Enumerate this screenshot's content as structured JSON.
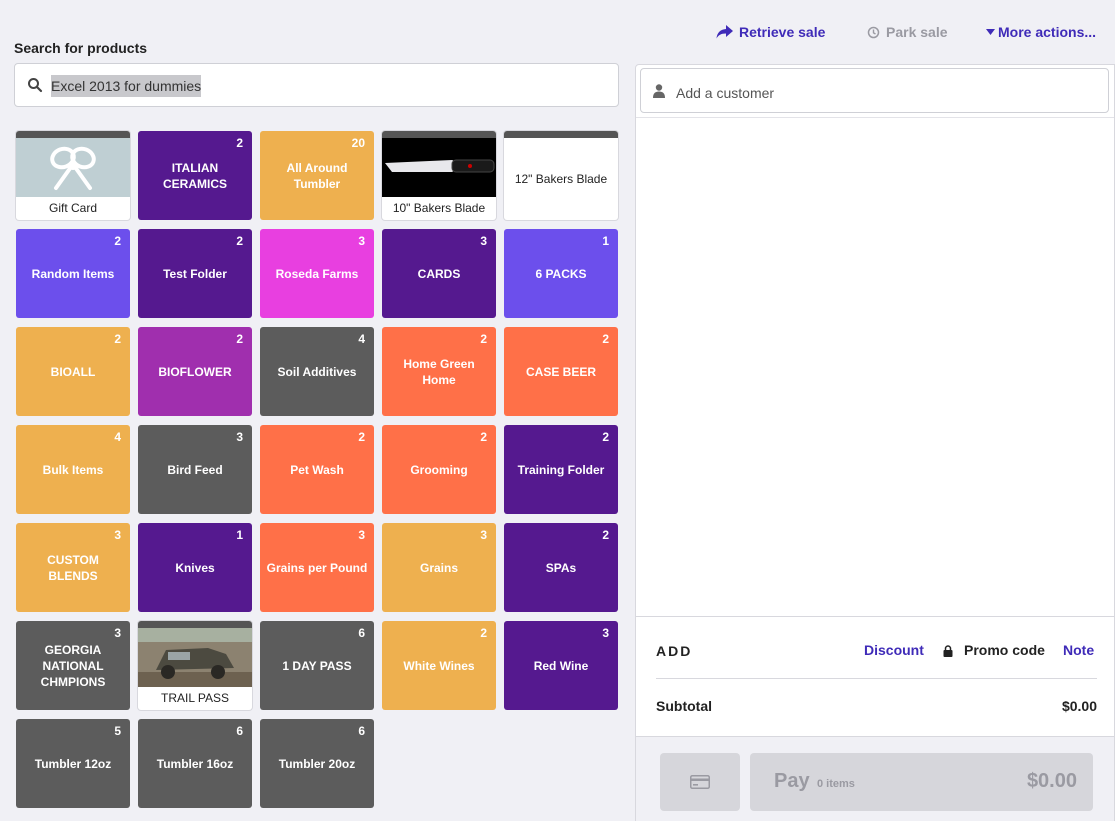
{
  "search": {
    "label": "Search for products",
    "value": "Excel 2013 for dummies"
  },
  "actions": {
    "retrieve": "Retrieve sale",
    "park": "Park sale",
    "more": "More actions..."
  },
  "customer": {
    "placeholder": "Add a customer"
  },
  "summary": {
    "add": "ADD",
    "discount": "Discount",
    "promo": "Promo code",
    "note": "Note",
    "subtotal_label": "Subtotal",
    "subtotal_value": "$0.00"
  },
  "pay": {
    "label": "Pay",
    "items": "0 items",
    "amount": "$0.00"
  },
  "colors": {
    "purple": "#55198f",
    "violet": "#6c4fec",
    "magenta": "#e83fe0",
    "orange": "#eeb04f",
    "coral": "#ff7048",
    "gray": "#5c5c5c",
    "plum": "#a02fae",
    "accent": "#3f2bb8"
  },
  "tiles": [
    {
      "name": "Gift Card",
      "kind": "product",
      "image": "gift-icon"
    },
    {
      "name": "ITALIAN CERAMICS",
      "count": "2",
      "color": "purple"
    },
    {
      "name": "All Around Tumbler",
      "count": "20",
      "color": "orange"
    },
    {
      "name": "10\" Bakers Blade",
      "kind": "product",
      "image": "knife-photo"
    },
    {
      "name": "12\" Bakers Blade",
      "kind": "product",
      "image": ""
    },
    {
      "name": "Random Items",
      "count": "2",
      "color": "violet"
    },
    {
      "name": "Test Folder",
      "count": "2",
      "color": "purple"
    },
    {
      "name": "Roseda Farms",
      "count": "3",
      "color": "magenta"
    },
    {
      "name": "CARDS",
      "count": "3",
      "color": "purple"
    },
    {
      "name": "6 PACKS",
      "count": "1",
      "color": "violet"
    },
    {
      "name": "BIOALL",
      "count": "2",
      "color": "orange"
    },
    {
      "name": "BIOFLOWER",
      "count": "2",
      "color": "plum"
    },
    {
      "name": "Soil Additives",
      "count": "4",
      "color": "gray"
    },
    {
      "name": "Home Green Home",
      "count": "2",
      "color": "coral"
    },
    {
      "name": "CASE BEER",
      "count": "2",
      "color": "coral"
    },
    {
      "name": "Bulk Items",
      "count": "4",
      "color": "orange"
    },
    {
      "name": "Bird Feed",
      "count": "3",
      "color": "gray"
    },
    {
      "name": "Pet Wash",
      "count": "2",
      "color": "coral"
    },
    {
      "name": "Grooming",
      "count": "2",
      "color": "coral"
    },
    {
      "name": "Training Folder",
      "count": "2",
      "color": "purple"
    },
    {
      "name": "CUSTOM BLENDS",
      "count": "3",
      "color": "orange"
    },
    {
      "name": "Knives",
      "count": "1",
      "color": "purple"
    },
    {
      "name": "Grains per Pound",
      "count": "3",
      "color": "coral"
    },
    {
      "name": "Grains",
      "count": "3",
      "color": "orange"
    },
    {
      "name": "SPAs",
      "count": "2",
      "color": "purple"
    },
    {
      "name": "GEORGIA NATIONAL CHMPIONS",
      "count": "3",
      "color": "gray"
    },
    {
      "name": "TRAIL PASS",
      "kind": "product",
      "image": "jeep-photo"
    },
    {
      "name": "1 DAY PASS",
      "count": "6",
      "color": "gray"
    },
    {
      "name": "White Wines",
      "count": "2",
      "color": "orange"
    },
    {
      "name": "Red Wine",
      "count": "3",
      "color": "purple"
    },
    {
      "name": "Tumbler 12oz",
      "count": "5",
      "color": "gray"
    },
    {
      "name": "Tumbler 16oz",
      "count": "6",
      "color": "gray"
    },
    {
      "name": "Tumbler 20oz",
      "count": "6",
      "color": "gray"
    }
  ]
}
